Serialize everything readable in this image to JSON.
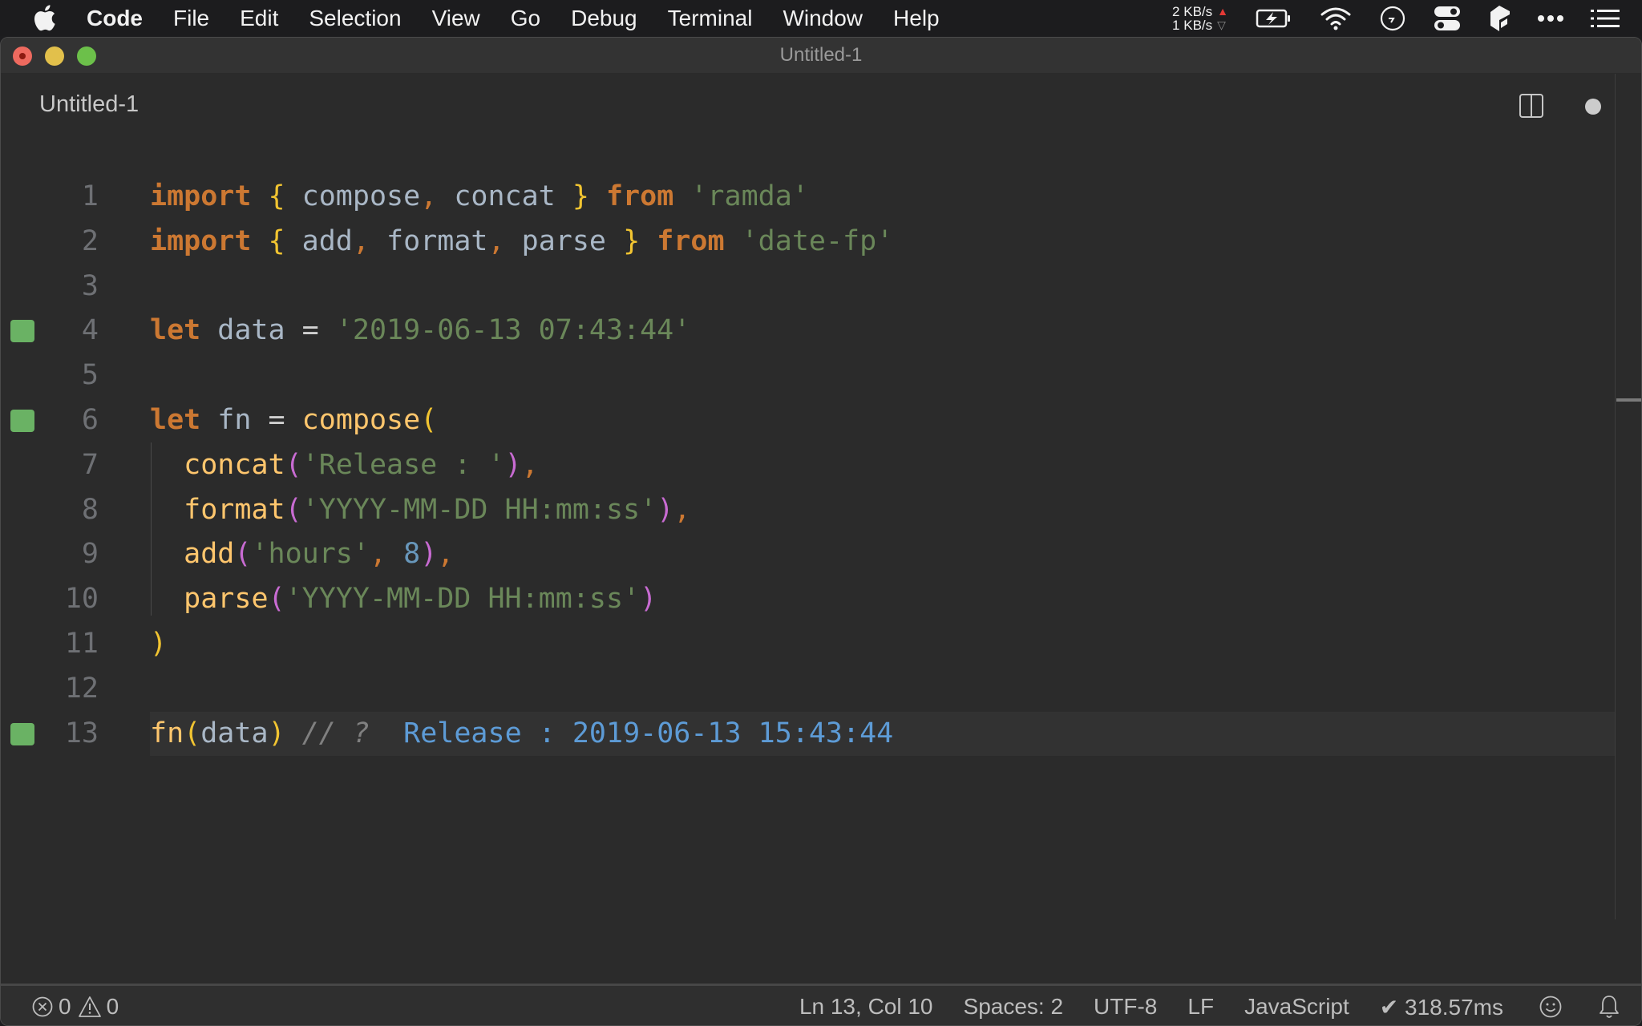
{
  "menubar": {
    "app_name": "Code",
    "items": [
      "File",
      "Edit",
      "Selection",
      "View",
      "Go",
      "Debug",
      "Terminal",
      "Window",
      "Help"
    ],
    "network": {
      "upload": "2 KB/s",
      "download": "1 KB/s"
    },
    "tray_icons": [
      "battery-charging-icon",
      "wifi-icon",
      "clock-icon",
      "toggle-control-icon",
      "cube-app-icon",
      "more-dots-icon",
      "list-menu-icon"
    ]
  },
  "window": {
    "title": "Untitled-1",
    "tab_label": "Untitled-1",
    "unsaved": true
  },
  "editor": {
    "language": "JavaScript",
    "colors": {
      "keyword": "#cc7832",
      "string": "#6a8759",
      "function": "#ffc66d",
      "identifier": "#a9b7c6",
      "number": "#6897bb",
      "brace": "#f1c431",
      "nested_paren": "#c86bd2",
      "inline_result": "#5d9bd6",
      "gutter_marker": "#6ab264"
    },
    "lines": [
      {
        "n": "1",
        "marker": false,
        "tokens": [
          [
            "kw",
            "import"
          ],
          [
            "op",
            " "
          ],
          [
            "brace",
            "{"
          ],
          [
            "id",
            " compose"
          ],
          [
            "punc",
            ","
          ],
          [
            "id",
            " concat "
          ],
          [
            "brace",
            "}"
          ],
          [
            "op",
            " "
          ],
          [
            "kw",
            "from"
          ],
          [
            "op",
            " "
          ],
          [
            "str",
            "'ramda'"
          ]
        ]
      },
      {
        "n": "2",
        "marker": false,
        "tokens": [
          [
            "kw",
            "import"
          ],
          [
            "op",
            " "
          ],
          [
            "brace",
            "{"
          ],
          [
            "id",
            " add"
          ],
          [
            "punc",
            ","
          ],
          [
            "id",
            " format"
          ],
          [
            "punc",
            ","
          ],
          [
            "id",
            " parse "
          ],
          [
            "brace",
            "}"
          ],
          [
            "op",
            " "
          ],
          [
            "kw",
            "from"
          ],
          [
            "op",
            " "
          ],
          [
            "str",
            "'date-fp'"
          ]
        ]
      },
      {
        "n": "3",
        "marker": false,
        "tokens": []
      },
      {
        "n": "4",
        "marker": true,
        "tokens": [
          [
            "kw",
            "let"
          ],
          [
            "id",
            " data "
          ],
          [
            "op",
            "="
          ],
          [
            "op",
            " "
          ],
          [
            "str",
            "'2019-06-13 07:43:44'"
          ]
        ]
      },
      {
        "n": "5",
        "marker": false,
        "tokens": []
      },
      {
        "n": "6",
        "marker": true,
        "tokens": [
          [
            "kw",
            "let"
          ],
          [
            "id",
            " fn "
          ],
          [
            "op",
            "="
          ],
          [
            "op",
            " "
          ],
          [
            "fn",
            "compose"
          ],
          [
            "brace",
            "("
          ]
        ]
      },
      {
        "n": "7",
        "marker": false,
        "tokens": [
          [
            "op",
            "  "
          ],
          [
            "fn",
            "concat"
          ],
          [
            "paren2",
            "("
          ],
          [
            "str",
            "'Release : '"
          ],
          [
            "paren2",
            ")"
          ],
          [
            "punc",
            ","
          ]
        ]
      },
      {
        "n": "8",
        "marker": false,
        "tokens": [
          [
            "op",
            "  "
          ],
          [
            "fn",
            "format"
          ],
          [
            "paren2",
            "("
          ],
          [
            "str",
            "'YYYY-MM-DD HH:mm:ss'"
          ],
          [
            "paren2",
            ")"
          ],
          [
            "punc",
            ","
          ]
        ]
      },
      {
        "n": "9",
        "marker": false,
        "tokens": [
          [
            "op",
            "  "
          ],
          [
            "fn",
            "add"
          ],
          [
            "paren2",
            "("
          ],
          [
            "str",
            "'hours'"
          ],
          [
            "punc",
            ","
          ],
          [
            "op",
            " "
          ],
          [
            "num",
            "8"
          ],
          [
            "paren2",
            ")"
          ],
          [
            "punc",
            ","
          ]
        ]
      },
      {
        "n": "10",
        "marker": false,
        "tokens": [
          [
            "op",
            "  "
          ],
          [
            "fn",
            "parse"
          ],
          [
            "paren2",
            "("
          ],
          [
            "str",
            "'YYYY-MM-DD HH:mm:ss'"
          ],
          [
            "paren2",
            ")"
          ]
        ]
      },
      {
        "n": "11",
        "marker": false,
        "tokens": [
          [
            "brace",
            ")"
          ]
        ]
      },
      {
        "n": "12",
        "marker": false,
        "tokens": []
      },
      {
        "n": "13",
        "marker": true,
        "current": true,
        "tokens": [
          [
            "fn",
            "fn"
          ],
          [
            "brace",
            "("
          ],
          [
            "id",
            "data"
          ],
          [
            "brace",
            ")"
          ],
          [
            "op",
            " "
          ],
          [
            "cmt",
            "// ?"
          ],
          [
            "op",
            "  "
          ],
          [
            "result",
            "Release : 2019-06-13 15:43:44"
          ]
        ]
      }
    ]
  },
  "statusbar": {
    "errors": "0",
    "warnings": "0",
    "cursor": "Ln 13, Col 10",
    "indent": "Spaces: 2",
    "encoding": "UTF-8",
    "eol": "LF",
    "language": "JavaScript",
    "timing": "✔ 318.57ms"
  }
}
